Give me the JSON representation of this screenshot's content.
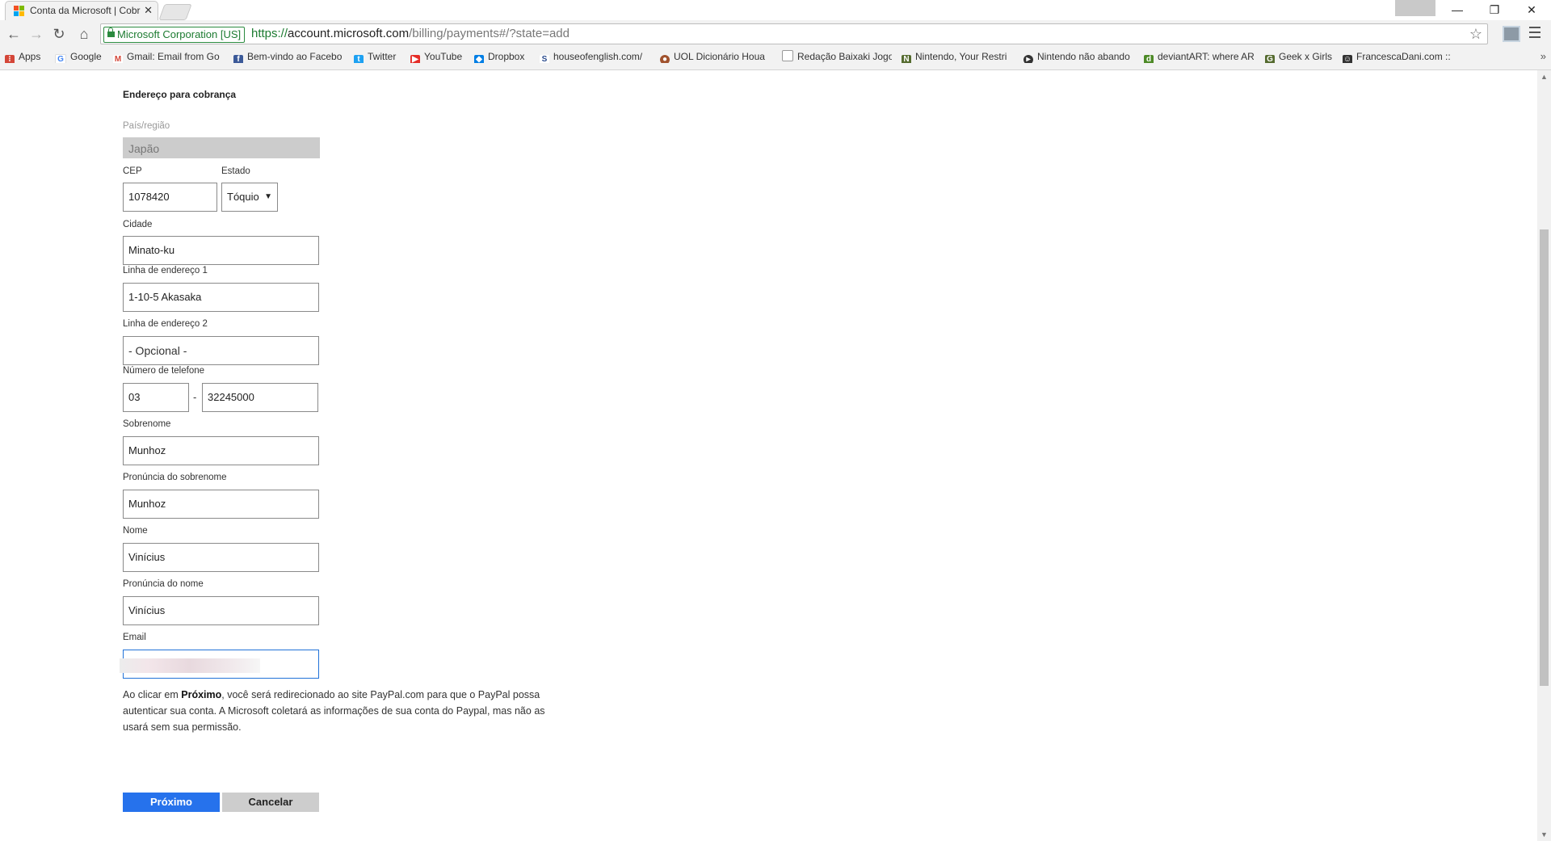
{
  "browser": {
    "tab_title": "Conta da Microsoft | Cobr",
    "tab_close": "✕",
    "window_buttons": [
      "—",
      "❐",
      "✕"
    ],
    "secure_label": "Microsoft Corporation [US]",
    "url_scheme": "https://",
    "url_host": "account.microsoft.com",
    "url_path": "/billing/payments#/?state=add",
    "bookmarks": [
      {
        "label": "Apps",
        "icon": "apps-grid-icon",
        "color": "#d44638"
      },
      {
        "label": "Google",
        "icon": "google-icon",
        "color": "#4285f4"
      },
      {
        "label": "Gmail: Email from Go",
        "icon": "gmail-icon",
        "color": "#d44638"
      },
      {
        "label": "Bem-vindo ao Facebo",
        "icon": "facebook-icon",
        "color": "#3b5998"
      },
      {
        "label": "Twitter",
        "icon": "twitter-icon",
        "color": "#1da1f2"
      },
      {
        "label": "YouTube",
        "icon": "youtube-icon",
        "color": "#e52d27"
      },
      {
        "label": "Dropbox",
        "icon": "dropbox-icon",
        "color": "#007ee5"
      },
      {
        "label": "houseofenglish.com/",
        "icon": "s-icon",
        "color": "#2a4b8d"
      },
      {
        "label": "UOL Dicionário Houa",
        "icon": "uol-icon",
        "color": "#a0522d"
      },
      {
        "label": "Redação Baixaki Jogo",
        "icon": "page-icon",
        "color": "#9e9e9e"
      },
      {
        "label": "Nintendo, Your Restri",
        "icon": "nintendo-icon",
        "color": "#556b2f"
      },
      {
        "label": "Nintendo não abando",
        "icon": "play-icon",
        "color": "#333333"
      },
      {
        "label": "deviantART: where AR",
        "icon": "deviantart-icon",
        "color": "#4d8a27"
      },
      {
        "label": "Geek x Girls",
        "icon": "geek-icon",
        "color": "#556b2f"
      },
      {
        "label": "FrancescaDani.com ::",
        "icon": "mask-icon",
        "color": "#333333"
      }
    ],
    "more_bookmarks": "»"
  },
  "form": {
    "section_title": "Endereço para cobrança",
    "country_label": "País/região",
    "country_value": "Japão",
    "cep_label": "CEP",
    "cep_value": "1078420",
    "state_label": "Estado",
    "state_value": "Tóquio",
    "city_label": "Cidade",
    "city_value": "Minato-ku",
    "address1_label": "Linha de endereço 1",
    "address1_value": "1-10-5 Akasaka",
    "address2_label": "Linha de endereço 2",
    "address2_placeholder": "- Opcional -",
    "phone_label": "Número de telefone",
    "phone_area": "03",
    "phone_separator": "-",
    "phone_number": "32245000",
    "surname_label": "Sobrenome",
    "surname_value": "Munhoz",
    "surname_pron_label": "Pronúncia do sobrenome",
    "surname_pron_value": "Munhoz",
    "name_label": "Nome",
    "name_value": "Vinícius",
    "name_pron_label": "Pronúncia do nome",
    "name_pron_value": "Vinícius",
    "email_label": "Email",
    "notice_prefix": "Ao clicar em ",
    "notice_bold": "Próximo",
    "notice_rest": ", você será redirecionado ao site PayPal.com para que o PayPal possa autenticar sua conta. A Microsoft coletará as informações de sua conta do Paypal, mas não as usará sem sua permissão.",
    "next_button": "Próximo",
    "cancel_button": "Cancelar"
  },
  "colors": {
    "primary_button": "#2672ec",
    "secure_green": "#1d7b31",
    "focus_border": "#2172d8"
  }
}
